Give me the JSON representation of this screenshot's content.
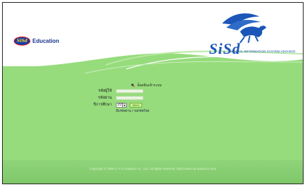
{
  "header": {
    "logo_badge": "SiSd",
    "logo_text": "Education",
    "brand_word": "SiSd",
    "brand_subtitle": "SCHOOL INFORMATION SYSTEM ADVANCE"
  },
  "login": {
    "title": "ล็อคอินเข้าระบบ",
    "username_label": "รหัสผู้ใช้",
    "username_value": "",
    "password_label": "รหัสผ่าน",
    "password_value": "",
    "year_label": "ปีการศึกษา",
    "year_value": "2552",
    "submit_label": "ตกลง",
    "links_text": "ลืมรหัสผ่าน / ขอรหัสใหม่"
  },
  "footer": {
    "copyright": "Copyright © 2009 C S S Advance co., Ltd. All rights reserved.   http://www.cst-advance.com"
  },
  "colors": {
    "background_green": "#96dc7c",
    "brand_blue": "#1b56b8",
    "logo_blue": "#12328a"
  }
}
